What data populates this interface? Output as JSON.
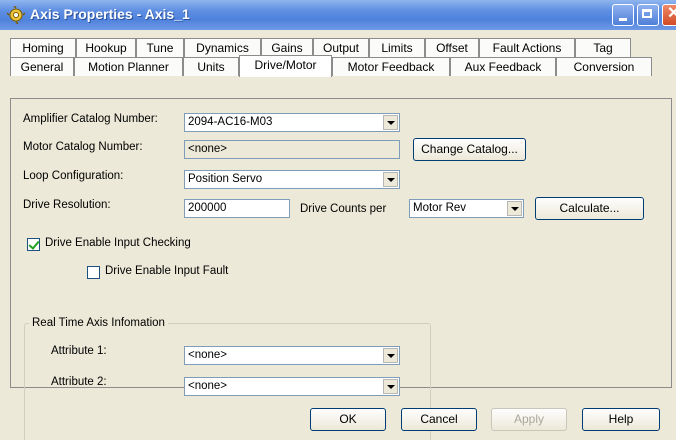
{
  "window": {
    "title": "Axis Properties - Axis_1",
    "close_glyph": "✕"
  },
  "tabs": {
    "row_back": [
      "Homing",
      "Hookup",
      "Tune",
      "Dynamics",
      "Gains",
      "Output",
      "Limits",
      "Offset",
      "Fault Actions",
      "Tag"
    ],
    "row_front": [
      "General",
      "Motion Planner",
      "Units",
      "Drive/Motor",
      "Motor Feedback",
      "Aux Feedback",
      "Conversion"
    ],
    "active": "Drive/Motor"
  },
  "form": {
    "amplifier_label": "Amplifier Catalog Number:",
    "amplifier_value": "2094-AC16-M03",
    "motor_label": "Motor Catalog Number:",
    "motor_value": "<none>",
    "change_catalog": "Change Catalog...",
    "loop_label": "Loop Configuration:",
    "loop_value": "Position Servo",
    "resolution_label": "Drive Resolution:",
    "resolution_value": "200000",
    "counts_per_label": "Drive Counts per",
    "counts_unit": "Motor Rev",
    "calculate": "Calculate...",
    "enable_checking_label": "Drive Enable Input Checking",
    "enable_checking_checked": true,
    "enable_fault_label": "Drive Enable Input Fault",
    "enable_fault_checked": false
  },
  "realtime": {
    "group_title": "Real Time Axis Infomation",
    "attr1_label": "Attribute 1:",
    "attr1_value": "<none>",
    "attr2_label": "Attribute 2:",
    "attr2_value": "<none>"
  },
  "buttons": {
    "ok": "OK",
    "cancel": "Cancel",
    "apply": "Apply",
    "help": "Help"
  }
}
